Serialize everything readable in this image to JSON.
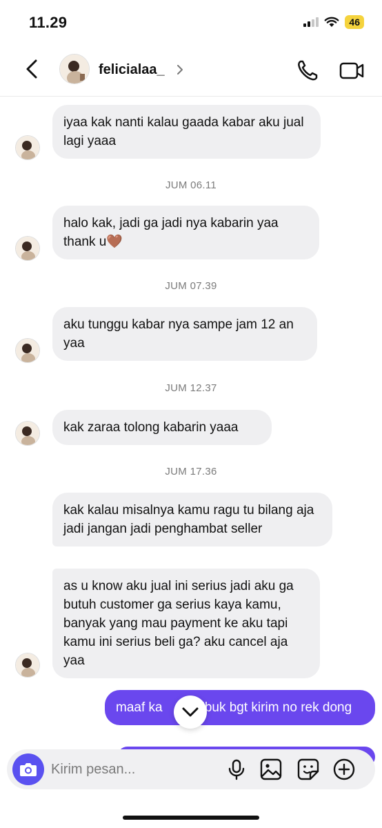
{
  "status_bar": {
    "time": "11.29",
    "battery": "46"
  },
  "header": {
    "username": "felicialaa_"
  },
  "messages": [
    {
      "type": "received",
      "text": "iyaa kak nanti kalau gaada kabar aku jual lagi yaaa"
    },
    {
      "type": "timestamp",
      "text": "JUM 06.11"
    },
    {
      "type": "received",
      "text": "halo kak, jadi ga jadi nya kabarin yaa thank u🤎"
    },
    {
      "type": "timestamp",
      "text": "JUM 07.39"
    },
    {
      "type": "received",
      "text": "aku tunggu kabar nya sampe jam 12 an yaa"
    },
    {
      "type": "timestamp",
      "text": "JUM 12.37"
    },
    {
      "type": "received",
      "text": "kak zaraa tolong kabarin yaaa"
    },
    {
      "type": "timestamp",
      "text": "JUM 17.36"
    },
    {
      "type": "received",
      "text": "kak kalau misalnya kamu ragu tu bilang aja jadi jangan jadi penghambat seller"
    },
    {
      "type": "received",
      "text": "as u know aku jual ini serius jadi aku ga butuh customer ga serius kaya kamu, banyak yang mau payment ke aku tapi kamu ini serius beli ga? aku cancel aja yaa"
    },
    {
      "type": "sent",
      "text": "maaf ka      g sibuk bgt kirim no rek dong"
    }
  ],
  "composer": {
    "placeholder": "Kirim pesan..."
  },
  "colors": {
    "sent_bubble": "#6a47ee",
    "received_bubble": "#efeff1",
    "camera_button": "#5a51f0",
    "battery": "#f5d33d"
  },
  "icons": [
    "back-arrow-icon",
    "chevron-right-icon",
    "phone-icon",
    "video-camera-icon",
    "camera-icon",
    "microphone-icon",
    "image-icon",
    "sticker-icon",
    "plus-icon",
    "chevron-down-icon"
  ]
}
